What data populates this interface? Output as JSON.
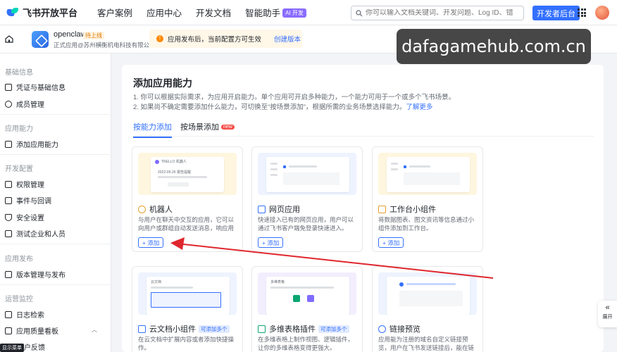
{
  "topbar": {
    "logo_text": "飞书开放平台",
    "nav": [
      "客户案例",
      "应用中心",
      "开发文档",
      "智能助手"
    ],
    "ai_badge": "AI 开发",
    "search_placeholder": "你可以输入文档关键词、开发问题、Log ID、错误码",
    "developer_button": "开发者后台"
  },
  "appbar": {
    "app_name": "openclaw",
    "app_status": "待上线",
    "app_company": "正式应用@苏州横衡机电科技有限公司",
    "notice_text": "应用发布后，当前配置方可生效",
    "notice_link": "创建版本"
  },
  "sidebar": {
    "groups": [
      {
        "title": "基础信息",
        "items": [
          "凭证与基础信息",
          "成员管理"
        ]
      },
      {
        "title": "应用能力",
        "items": [
          "添加应用能力"
        ]
      },
      {
        "title": "开发配置",
        "items": [
          "权限管理",
          "事件与回调",
          "安全设置",
          "测试企业和人员"
        ]
      },
      {
        "title": "应用发布",
        "items": [
          "版本管理与发布"
        ]
      },
      {
        "title": "运营监控",
        "items": [
          "日志检索",
          "应用质量看板",
          "用户反馈"
        ]
      }
    ],
    "tooltip": "显示菜单"
  },
  "main": {
    "title": "添加应用能力",
    "desc1": "1. 你可以根据实际需求，为应用开启能力。单个应用可开启多种能力，一个能力可用于一个或多个飞书场景。",
    "desc2": "2. 如果尚不确定需要添加什么能力，可切换至“按场景添加”，根据所需的业务场景选择能力。",
    "desc2_link": "了解更多",
    "tabs": [
      {
        "label": "按能力添加",
        "active": true
      },
      {
        "label": "按场景添加",
        "badge": "new"
      }
    ],
    "add_label": "+ 添加",
    "cards": [
      {
        "title": "机器人",
        "tag": "",
        "desc": "与用户在聊天中交互的应用，它可以向用户或群组自动发送消息，响应用户的消...",
        "thumb_text1": "2022-05-26 报告提醒",
        "thumb_text2": "TRELLO 机器人"
      },
      {
        "title": "网页应用",
        "tag": "",
        "desc": "快速接入已有的网页应用，用户可以通过飞书客户端免登录快速进入。",
        "thumb_text1": "",
        "thumb_text2": ""
      },
      {
        "title": "工作台小组件",
        "tag": "",
        "desc": "将数据图表、图文资讯等信息通过小组件添加到工作台。",
        "thumb_text1": "",
        "thumb_text2": ""
      },
      {
        "title": "云文档小组件",
        "tag": "可添加多个",
        "desc": "在云文档中扩展内容或者添加快捷操作。",
        "thumb_text1": "云文档",
        "thumb_text2": ""
      },
      {
        "title": "多维表格插件",
        "tag": "可添加多个",
        "desc": "在多维表格上制作视图、逻辑插件，让你的多维表格变得更强大。",
        "thumb_text1": "多维表格",
        "thumb_text2": ""
      },
      {
        "title": "链接预览",
        "tag": "",
        "desc": "应用能为注册的域名自定义链接预览，用户在飞书发送链接后，能在链接下方展...",
        "thumb_text1": "",
        "thumb_text2": ""
      }
    ]
  },
  "watermark": "dafagamehub.com.cn",
  "expand_label": "展开",
  "colors": {
    "primary": "#3370ff",
    "warning": "#ff8800",
    "arrow": "#e0262d"
  }
}
